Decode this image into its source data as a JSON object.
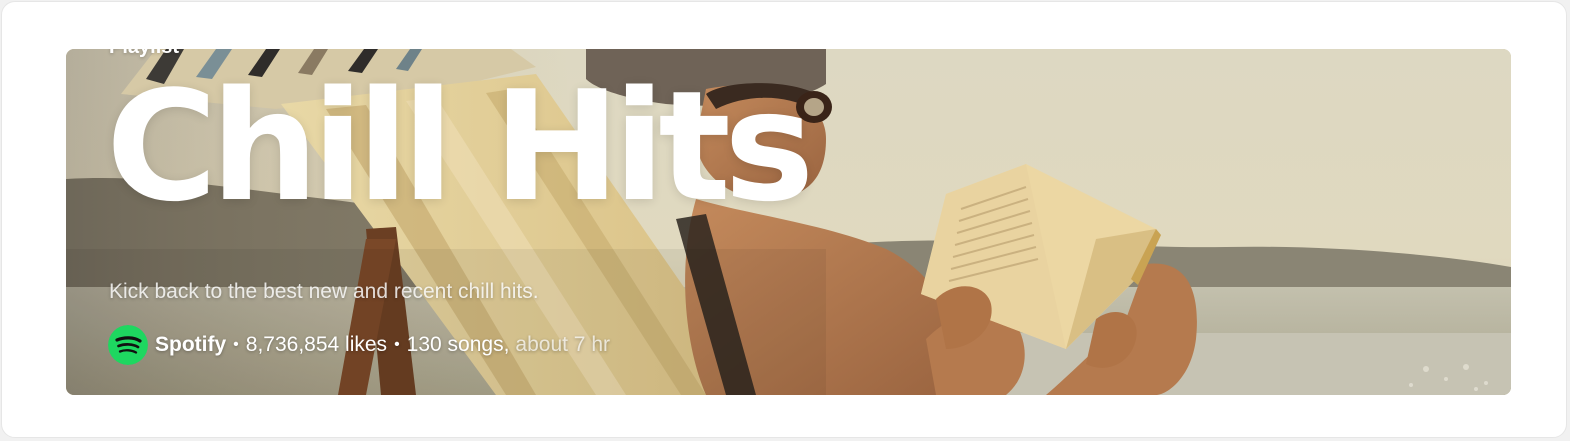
{
  "playlist": {
    "type_label": "Playlist",
    "title": "Chill Hits",
    "description": "Kick back to the best new and recent chill hits.",
    "owner": "Spotify",
    "separator": "•",
    "likes": "8,736,854 likes",
    "songs": "130 songs,",
    "duration": "about 7 hr"
  },
  "icons": {
    "owner_logo": "spotify-logo-icon",
    "cover": "beach-reader-cover-image"
  },
  "colors": {
    "brand_green": "#1ed760",
    "text": "#ffffff"
  }
}
